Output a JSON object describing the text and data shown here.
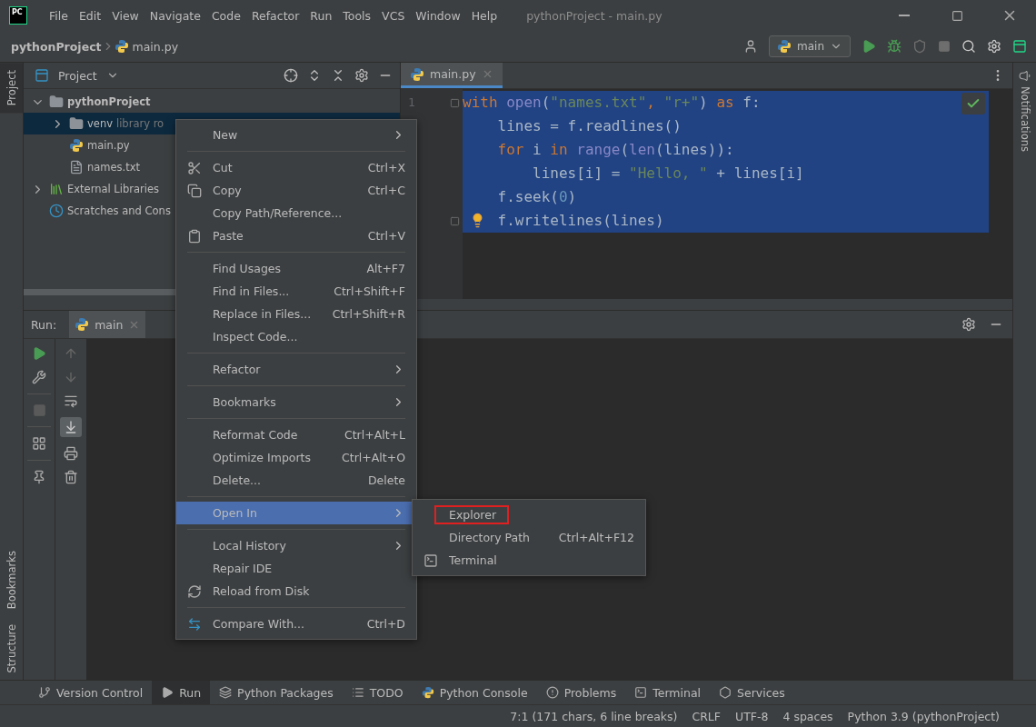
{
  "window": {
    "logo": "PC",
    "title": "pythonProject - main.py",
    "menu": [
      "File",
      "Edit",
      "View",
      "Navigate",
      "Code",
      "Refactor",
      "Run",
      "Tools",
      "VCS",
      "Window",
      "Help"
    ]
  },
  "navbar": {
    "breadcrumbs": [
      "pythonProject",
      "main.py"
    ],
    "run_config": "main"
  },
  "side_tabs_left": [
    {
      "label": "Project",
      "selected": true
    },
    {
      "label": "Bookmarks",
      "selected": false
    },
    {
      "label": "Structure",
      "selected": false
    }
  ],
  "side_tabs_right": [
    {
      "label": "Notifications"
    }
  ],
  "project_panel": {
    "title": "Project",
    "tree": [
      {
        "label": "pythonProject",
        "kind": "folder",
        "expanded": true,
        "selected": false,
        "children": [
          {
            "label": "venv",
            "hint": "library ro",
            "kind": "folder",
            "expanded": false,
            "selected": true
          },
          {
            "label": "main.py",
            "kind": "python",
            "selected": false
          },
          {
            "label": "names.txt",
            "kind": "text",
            "selected": false
          }
        ]
      },
      {
        "label": "External Libraries",
        "kind": "libraries",
        "expanded": false,
        "selected": false
      },
      {
        "label": "Scratches and Cons",
        "kind": "scratches",
        "selected": false
      }
    ]
  },
  "editor": {
    "tabs": [
      {
        "label": "main.py",
        "selected": true
      }
    ],
    "line_numbers": [
      "1"
    ],
    "code_selected": true,
    "lines": [
      {
        "fold": true,
        "intention": false,
        "tokens": [
          {
            "t": "with",
            "kind": "keyword"
          },
          {
            "t": " open",
            "kind": "builtin"
          },
          {
            "t": "(",
            "kind": "plain"
          },
          {
            "t": "\"names.txt\"",
            "kind": "string"
          },
          {
            "t": ", ",
            "kind": "keyword"
          },
          {
            "t": "\"r+\"",
            "kind": "string"
          },
          {
            "t": ") ",
            "kind": "plain"
          },
          {
            "t": "as",
            "kind": "keyword"
          },
          {
            "t": " f:",
            "kind": "plain"
          }
        ]
      },
      {
        "intention": false,
        "tokens": [
          {
            "t": "    lines = f.readlines()",
            "kind": "plain"
          }
        ]
      },
      {
        "intention": false,
        "tokens": [
          {
            "t": "    for",
            "kind": "keyword"
          },
          {
            "t": " i ",
            "kind": "plain"
          },
          {
            "t": "in",
            "kind": "keyword"
          },
          {
            "t": " range",
            "kind": "builtin"
          },
          {
            "t": "(",
            "kind": "plain"
          },
          {
            "t": "len",
            "kind": "builtin"
          },
          {
            "t": "(lines)):",
            "kind": "plain"
          }
        ]
      },
      {
        "intention": false,
        "tokens": [
          {
            "t": "        lines[i] = ",
            "kind": "plain"
          },
          {
            "t": "\"Hello, \"",
            "kind": "string"
          },
          {
            "t": " + lines[i]",
            "kind": "plain"
          }
        ]
      },
      {
        "intention": false,
        "tokens": [
          {
            "t": "    f.seek(",
            "kind": "plain"
          },
          {
            "t": "0",
            "kind": "number"
          },
          {
            "t": ")",
            "kind": "plain"
          }
        ]
      },
      {
        "fold": true,
        "intention": true,
        "tokens": [
          {
            "t": "    f.writelines(lines)",
            "kind": "plain"
          }
        ]
      }
    ]
  },
  "run_panel": {
    "label": "Run:",
    "tabs": [
      {
        "label": "main",
        "selected": true
      }
    ],
    "autoscroll_on": true
  },
  "context_menu": {
    "groups": [
      [
        {
          "label": "New",
          "submenu": true,
          "selected": false,
          "kind": "none"
        }
      ],
      [
        {
          "label": "Cut",
          "submenu": false,
          "selected": false,
          "kind": "cut",
          "shortcut": "Ctrl+X"
        },
        {
          "label": "Copy",
          "submenu": false,
          "selected": false,
          "kind": "copy",
          "shortcut": "Ctrl+C"
        },
        {
          "label": "Copy Path/Reference...",
          "submenu": false,
          "selected": false,
          "kind": "none"
        },
        {
          "label": "Paste",
          "submenu": false,
          "selected": false,
          "kind": "paste",
          "shortcut": "Ctrl+V"
        }
      ],
      [
        {
          "label": "Find Usages",
          "submenu": false,
          "selected": false,
          "kind": "none",
          "shortcut": "Alt+F7"
        },
        {
          "label": "Find in Files...",
          "submenu": false,
          "selected": false,
          "kind": "none",
          "shortcut": "Ctrl+Shift+F"
        },
        {
          "label": "Replace in Files...",
          "submenu": false,
          "selected": false,
          "kind": "none",
          "shortcut": "Ctrl+Shift+R"
        },
        {
          "label": "Inspect Code...",
          "submenu": false,
          "selected": false,
          "kind": "none"
        }
      ],
      [
        {
          "label": "Refactor",
          "submenu": true,
          "selected": false,
          "kind": "none"
        }
      ],
      [
        {
          "label": "Bookmarks",
          "submenu": true,
          "selected": false,
          "kind": "none"
        }
      ],
      [
        {
          "label": "Reformat Code",
          "submenu": false,
          "selected": false,
          "kind": "none",
          "shortcut": "Ctrl+Alt+L"
        },
        {
          "label": "Optimize Imports",
          "submenu": false,
          "selected": false,
          "kind": "none",
          "shortcut": "Ctrl+Alt+O"
        },
        {
          "label": "Delete...",
          "submenu": false,
          "selected": false,
          "kind": "none",
          "shortcut": "Delete"
        }
      ],
      [
        {
          "label": "Open In",
          "submenu": true,
          "selected": true,
          "kind": "none"
        }
      ],
      [
        {
          "label": "Local History",
          "submenu": true,
          "selected": false,
          "kind": "none"
        },
        {
          "label": "Repair IDE",
          "submenu": false,
          "selected": false,
          "kind": "none"
        },
        {
          "label": "Reload from Disk",
          "submenu": false,
          "selected": false,
          "kind": "reload"
        }
      ],
      [
        {
          "label": "Compare With...",
          "submenu": false,
          "selected": false,
          "kind": "compare",
          "shortcut": "Ctrl+D"
        }
      ]
    ]
  },
  "submenu": {
    "items": [
      {
        "label": "Explorer",
        "outlined": true,
        "kind": "none"
      },
      {
        "label": "Directory Path",
        "outlined": false,
        "kind": "none",
        "shortcut": "Ctrl+Alt+F12"
      },
      {
        "label": "Terminal",
        "outlined": false,
        "kind": "terminal"
      }
    ]
  },
  "tool_tabs": [
    {
      "label": "Version Control",
      "kind": "git",
      "selected": false
    },
    {
      "label": "Run",
      "kind": "run",
      "selected": true
    },
    {
      "label": "Python Packages",
      "kind": "packages",
      "selected": false
    },
    {
      "label": "TODO",
      "kind": "todo",
      "selected": false
    },
    {
      "label": "Python Console",
      "kind": "console",
      "selected": false
    },
    {
      "label": "Problems",
      "kind": "problems",
      "selected": false
    },
    {
      "label": "Terminal",
      "kind": "terminal",
      "selected": false
    },
    {
      "label": "Services",
      "kind": "services",
      "selected": false
    }
  ],
  "status_bar": {
    "items": [
      "7:1 (171 chars, 6 line breaks)",
      "CRLF",
      "UTF-8",
      "4 spaces",
      "Python 3.9 (pythonProject)"
    ]
  }
}
